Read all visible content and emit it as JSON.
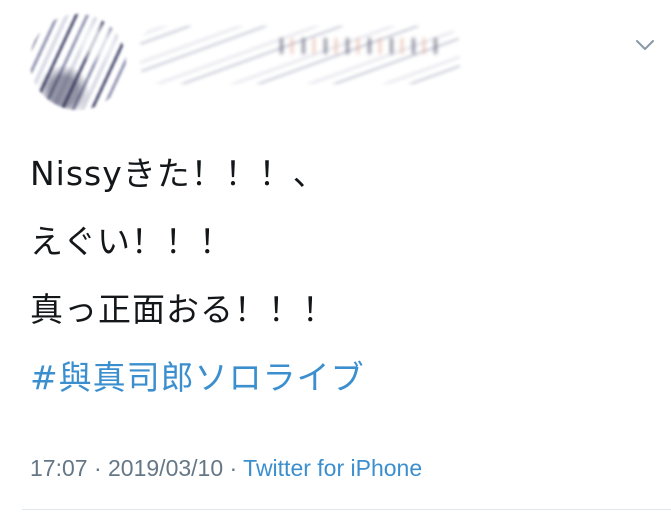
{
  "tweet": {
    "author": {
      "avatar_icon": "avatar-redacted",
      "display_name": "",
      "handle": ""
    },
    "more_icon": "chevron-down-icon",
    "lines": [
      "Nissyきた！！！、",
      "えぐい！！！",
      "真っ正面おる！！！"
    ],
    "hashtag": "#與真司郎ソロライブ",
    "time": "17:07",
    "separator_1": " · ",
    "date": "2019/03/10",
    "separator_2": " · ",
    "source": "Twitter for iPhone"
  },
  "colors": {
    "text": "#14171a",
    "link": "#3c8fcf",
    "muted": "#657786",
    "divider": "#e1e8ed"
  }
}
